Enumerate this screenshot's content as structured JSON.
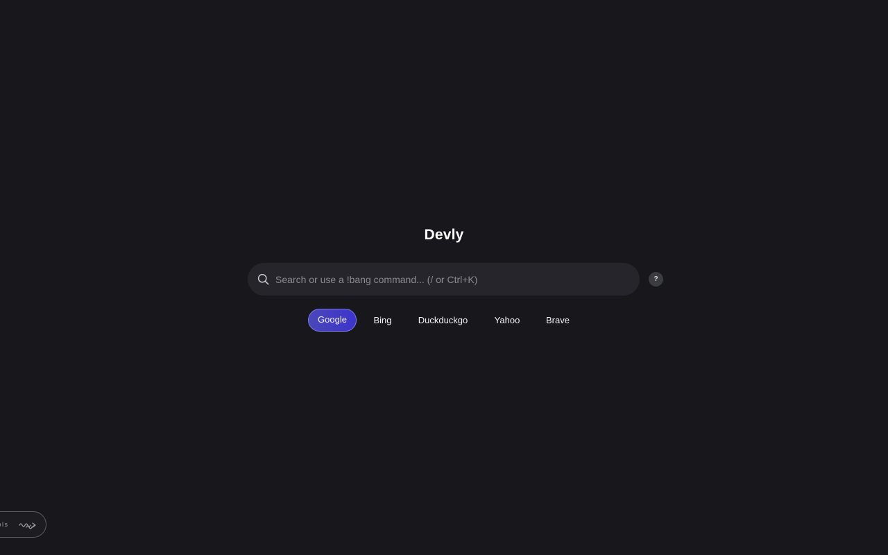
{
  "app": {
    "title": "Devly"
  },
  "search": {
    "placeholder": "Search or use a !bang command... (/ or Ctrl+K)",
    "value": "",
    "icon": "search-icon"
  },
  "help": {
    "label": "?"
  },
  "engines": [
    {
      "label": "Google",
      "active": true
    },
    {
      "label": "Bing",
      "active": false
    },
    {
      "label": "Duckduckgo",
      "active": false
    },
    {
      "label": "Yahoo",
      "active": false
    },
    {
      "label": "Brave",
      "active": false
    }
  ],
  "tools": {
    "label": "ools",
    "icon": "squiggle-arrow-icon"
  },
  "colors": {
    "background": "#18181c",
    "search_bg": "#25252b",
    "accent": "#3d34cc",
    "accent_border": "#7d7ae6"
  }
}
